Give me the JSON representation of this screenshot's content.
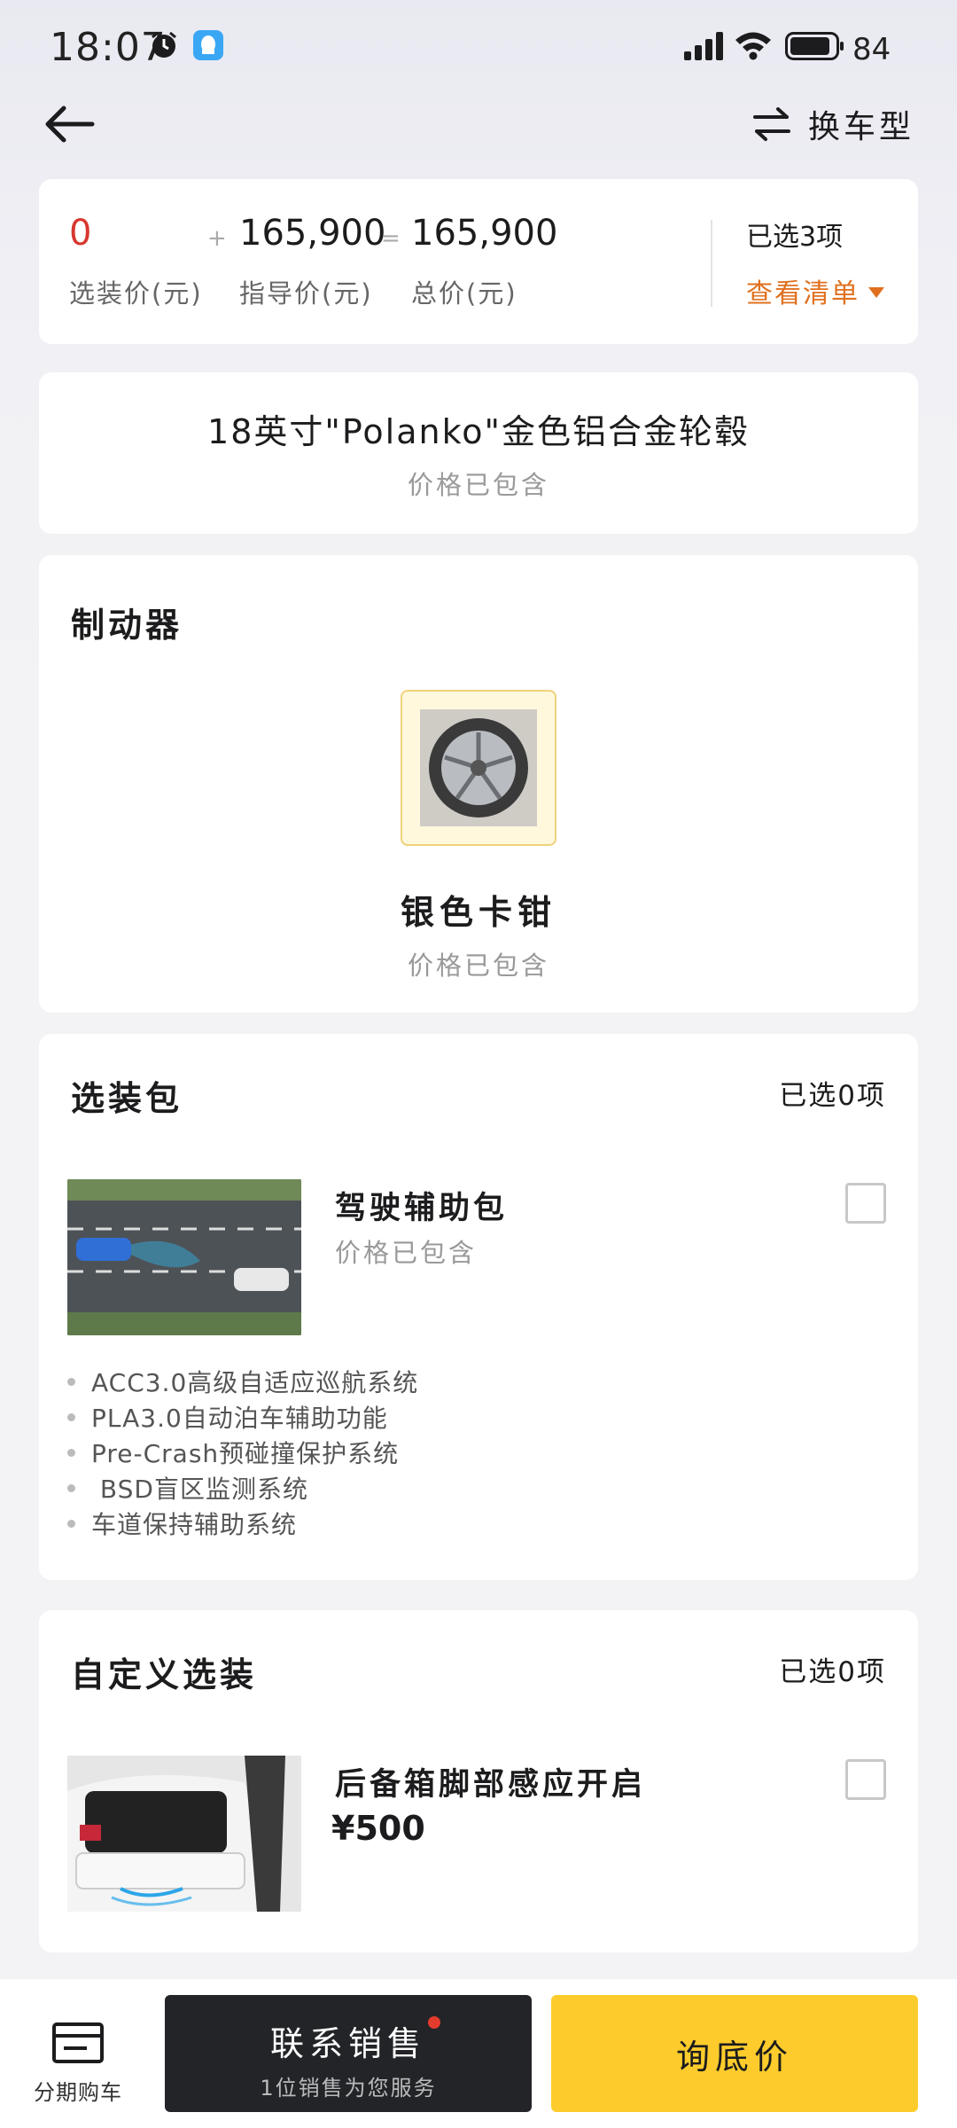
{
  "status_bar": {
    "time": "18:07",
    "battery": "84"
  },
  "nav": {
    "switch_label": "换车型"
  },
  "price_summary": {
    "option_price": "0",
    "option_price_label": "选装价(元)",
    "plus": "+",
    "guide_price": "165,900",
    "guide_price_label": "指导价(元)",
    "equals": "=",
    "total_price": "165,900",
    "total_price_label": "总价(元)",
    "selected_count": "已选3项",
    "view_list": "查看清单"
  },
  "wheel": {
    "name": "18英寸\"Polanko\"金色铝合金轮毂",
    "price_note": "价格已包含"
  },
  "brake": {
    "title": "制动器",
    "option_name": "银色卡钳",
    "price_note": "价格已包含"
  },
  "packages": {
    "title": "选装包",
    "selected_count": "已选0项",
    "items": [
      {
        "name": "驾驶辅助包",
        "price_note": "价格已包含",
        "features": [
          "ACC3.0高级自适应巡航系统",
          "PLA3.0自动泊车辅助功能",
          "Pre-Crash预碰撞保护系统",
          " BSD盲区监测系统",
          "车道保持辅助系统"
        ]
      }
    ]
  },
  "custom_options": {
    "title": "自定义选装",
    "selected_count": "已选0项",
    "items": [
      {
        "name": "后备箱脚部感应开启",
        "price": "¥500"
      }
    ]
  },
  "bottom_bar": {
    "installment_label": "分期购车",
    "contact_title": "联系销售",
    "contact_subtitle": "1位销售为您服务",
    "ask_price": "询底价"
  },
  "colors": {
    "accent_orange": "#e0701e",
    "price_red": "#d7372e",
    "cta_yellow": "#fdcc2c",
    "dark_button": "#222428"
  }
}
